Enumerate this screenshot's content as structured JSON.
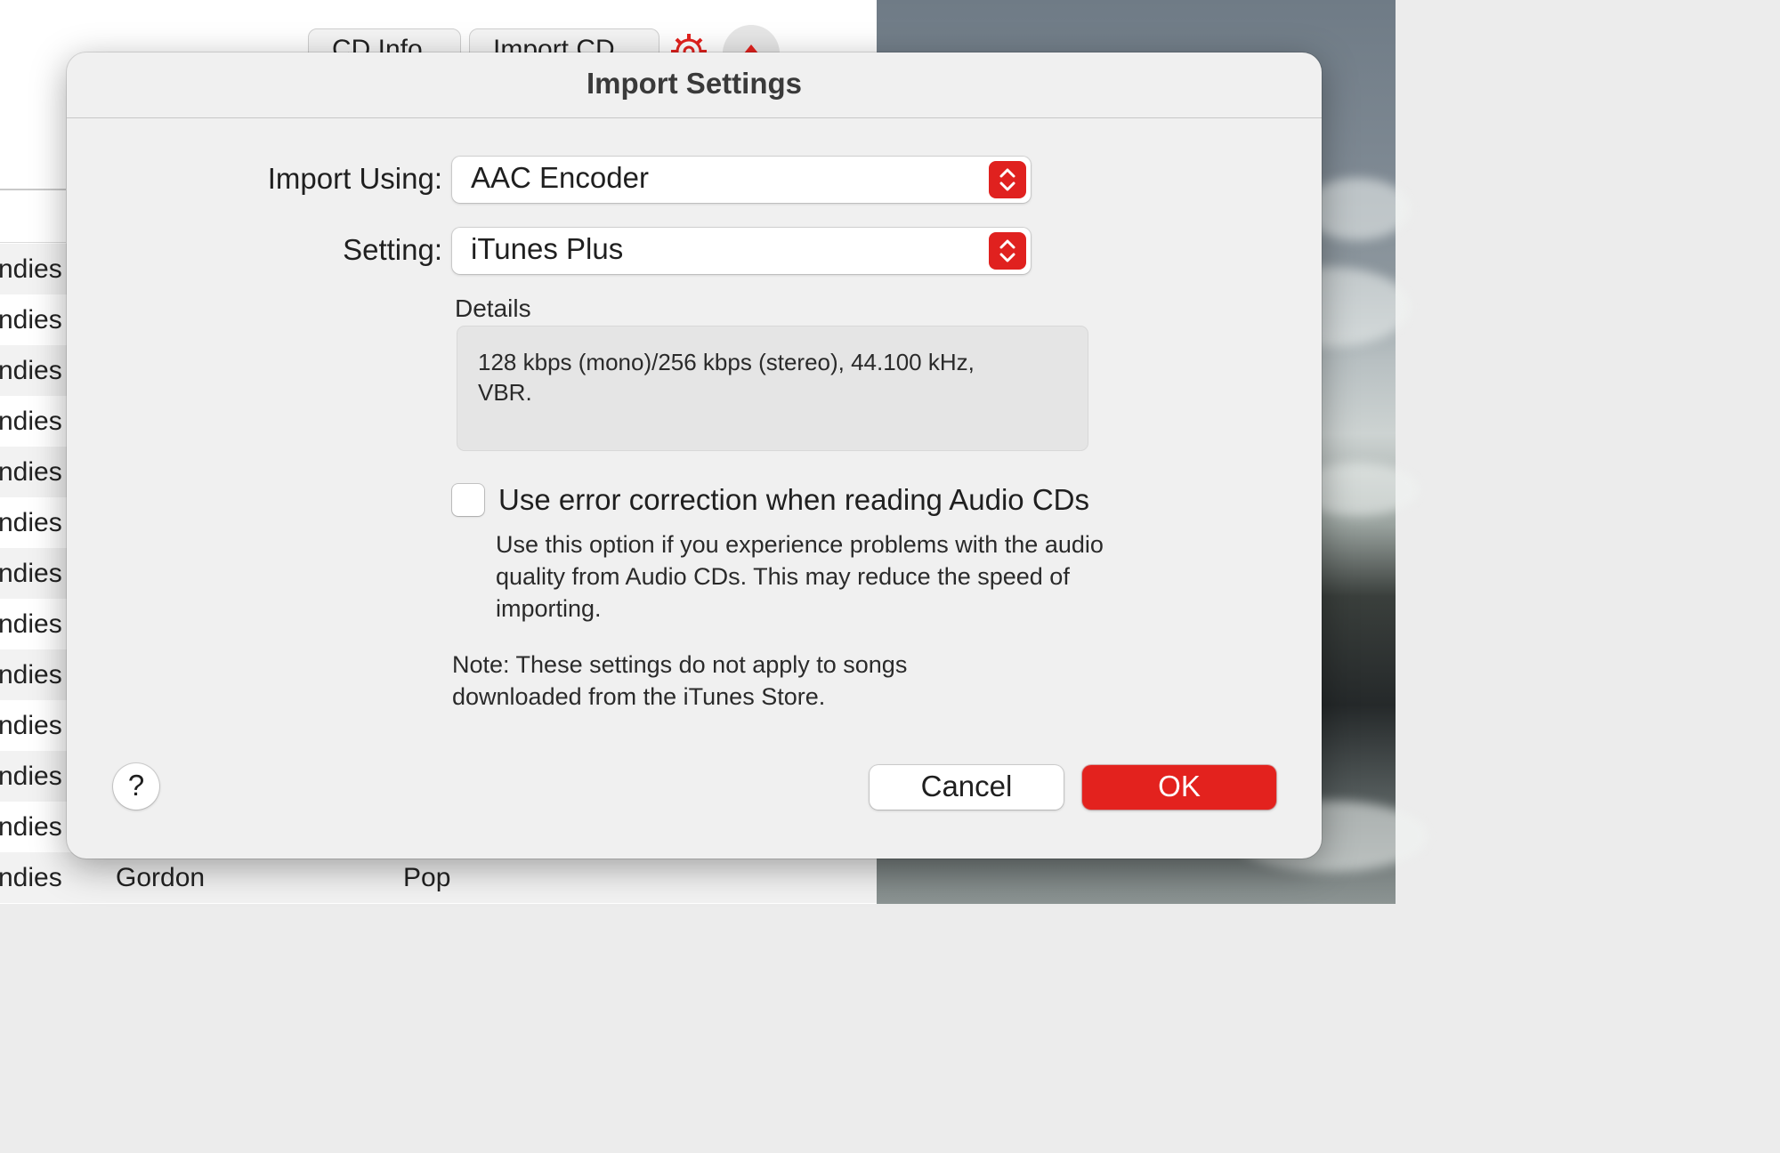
{
  "background_window": {
    "toolbar": {
      "cd_info_label": "CD Info",
      "import_cd_label": "Import CD"
    },
    "rows": [
      {
        "genre": "ndies",
        "artist": "",
        "kind": ""
      },
      {
        "genre": "ndies",
        "artist": "",
        "kind": ""
      },
      {
        "genre": "ndies",
        "artist": "",
        "kind": ""
      },
      {
        "genre": "ndies",
        "artist": "",
        "kind": ""
      },
      {
        "genre": "ndies",
        "artist": "",
        "kind": ""
      },
      {
        "genre": "ndies",
        "artist": "",
        "kind": ""
      },
      {
        "genre": "ndies",
        "artist": "",
        "kind": ""
      },
      {
        "genre": "ndies",
        "artist": "",
        "kind": ""
      },
      {
        "genre": "ndies",
        "artist": "",
        "kind": ""
      },
      {
        "genre": "ndies",
        "artist": "",
        "kind": ""
      },
      {
        "genre": "ndies",
        "artist": "",
        "kind": ""
      },
      {
        "genre": "ndies",
        "artist": "",
        "kind": ""
      },
      {
        "genre": "ndies",
        "artist": "Gordon",
        "kind": "Pop"
      }
    ]
  },
  "dialog": {
    "title": "Import Settings",
    "import_using": {
      "label": "Import Using:",
      "value": "AAC Encoder"
    },
    "setting": {
      "label": "Setting:",
      "value": "iTunes Plus"
    },
    "details": {
      "label": "Details",
      "text": "128 kbps (mono)/256 kbps (stereo), 44.100 kHz, VBR."
    },
    "error_correction": {
      "label": "Use error correction when reading Audio CDs",
      "checked": false,
      "help": "Use this option if you experience problems with the audio quality from Audio CDs. This may reduce the speed of importing."
    },
    "note": "Note: These settings do not apply to songs downloaded from the iTunes Store.",
    "help_button": "?",
    "cancel_label": "Cancel",
    "ok_label": "OK"
  },
  "colors": {
    "accent_red": "#e3221e",
    "dialog_bg": "#f0f0f0"
  }
}
